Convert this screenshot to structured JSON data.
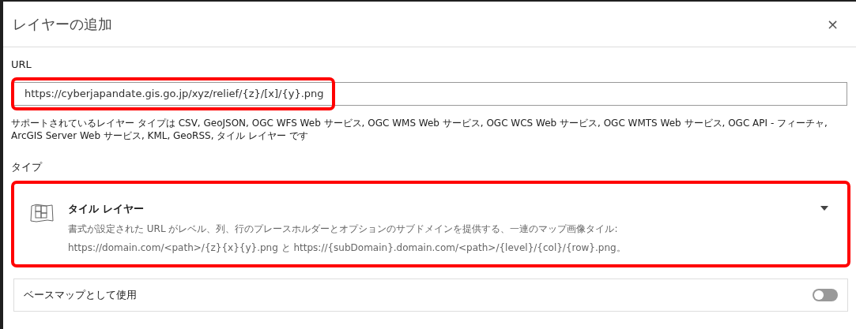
{
  "dialog": {
    "title": "レイヤーの追加",
    "close": "×"
  },
  "url": {
    "label": "URL",
    "value": "https://cyberjapandate.gis.go.jp/xyz/relief/{z}/[x]/{y}.png",
    "highlighted": true,
    "help": "サポートされているレイヤー タイプは CSV, GeoJSON, OGC WFS Web サービス, OGC WMS Web サービス, OGC WCS Web サービス, OGC WMTS Web サービス, OGC API - フィーチャ, ArcGIS Server Web サービス, KML, GeoRSS, タイル レイヤー です"
  },
  "type": {
    "label": "タイプ",
    "highlighted": true,
    "title": "タイル レイヤー",
    "description": "書式が設定された URL がレベル、列、行のプレースホルダーとオプションのサブドメインを提供する、一連のマップ画像タイル:",
    "examples": "https://domain.com/<path>/{z}{x}{y}.png と https://{subDomain}.domain.com/<path>/{level}/{col}/{row}.png。"
  },
  "basemap": {
    "label": "ベースマップとして使用",
    "on": false
  }
}
